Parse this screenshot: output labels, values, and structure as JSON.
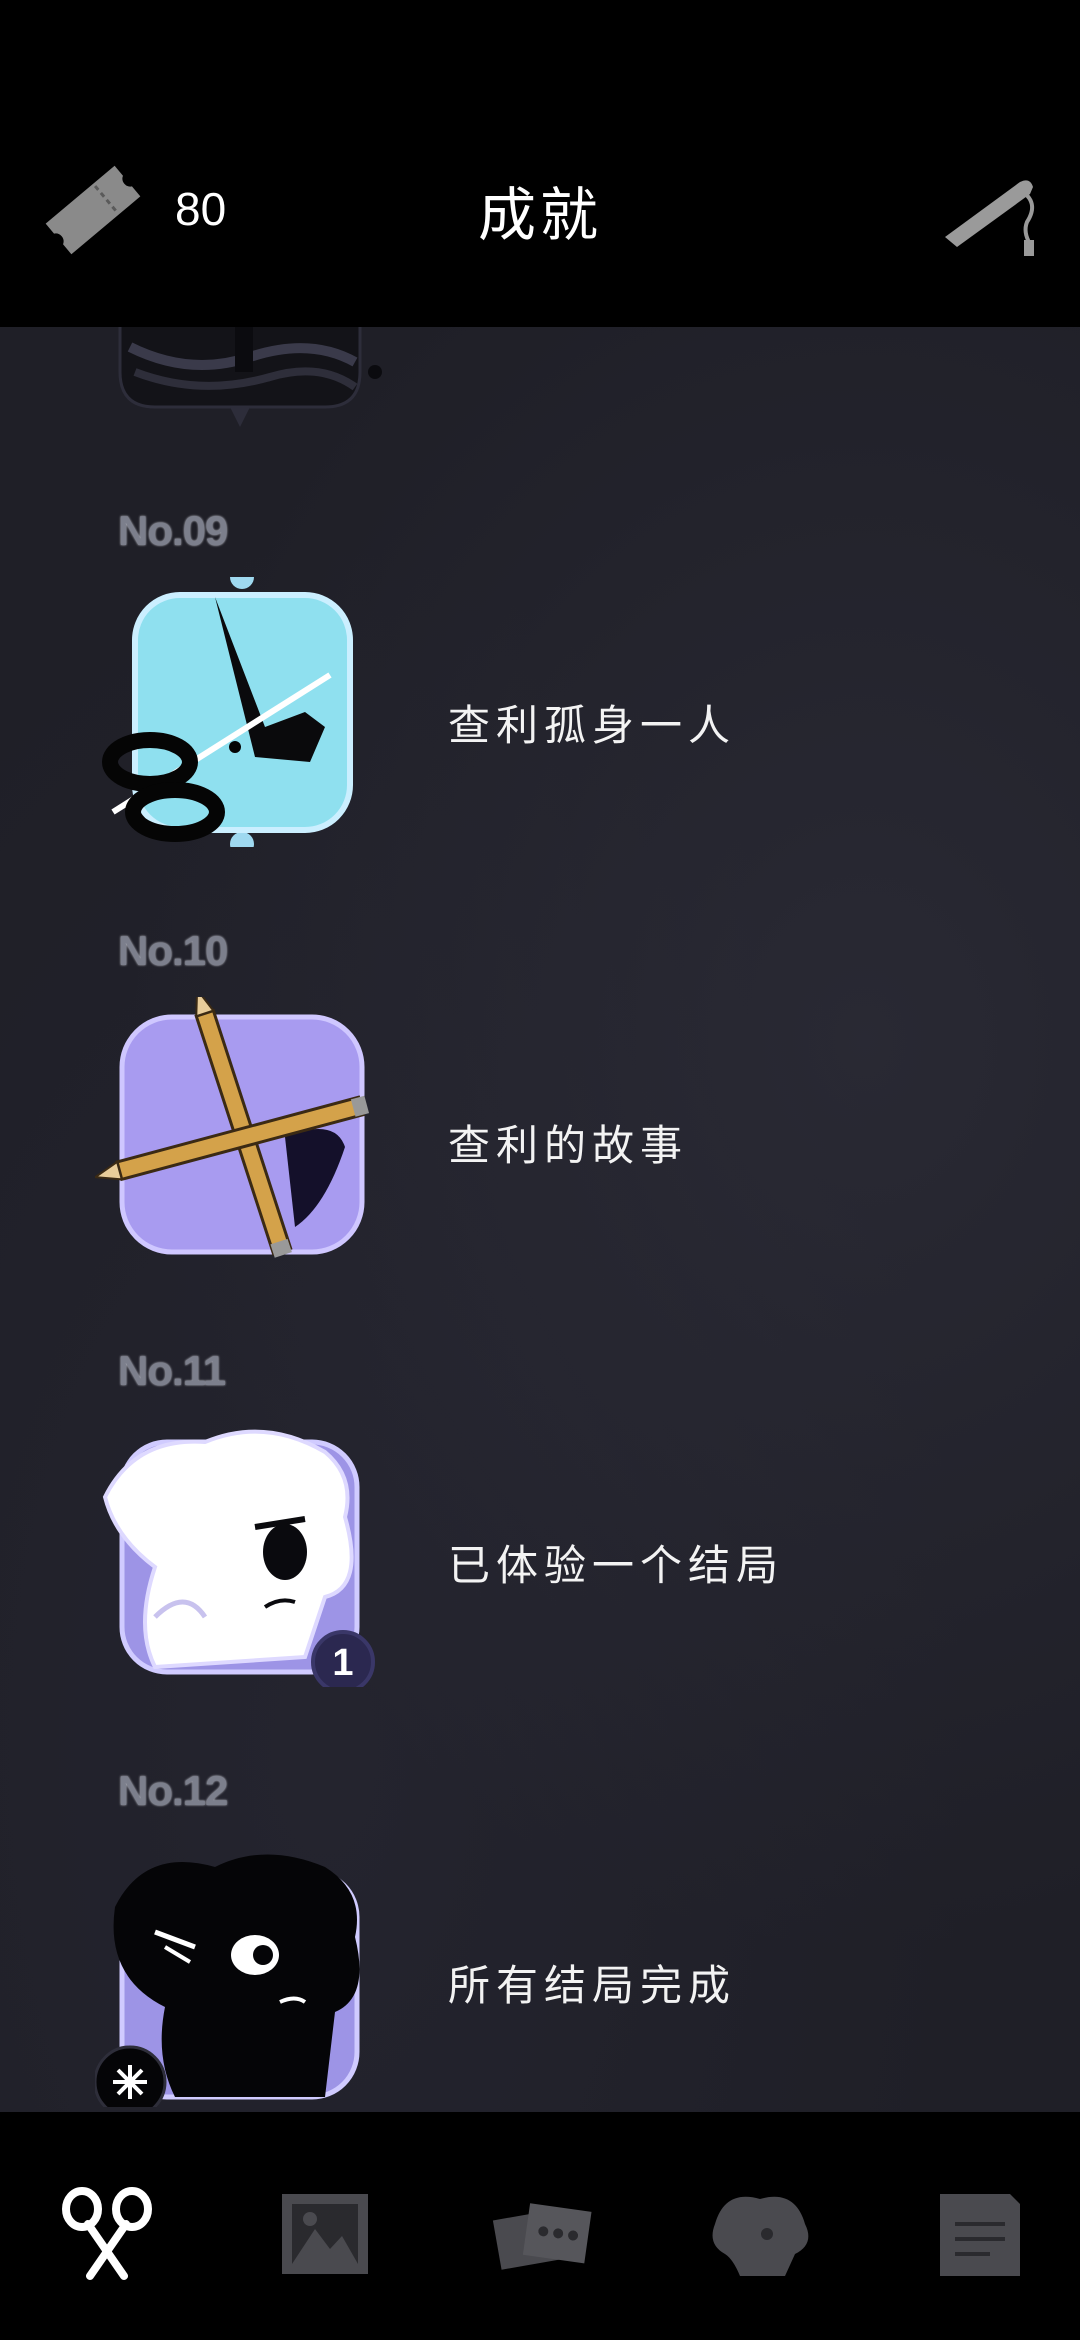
{
  "header": {
    "ticket_count": "80",
    "title": "成就",
    "left_icon": "ticket-icon",
    "right_icon": "whistle-icon"
  },
  "achievements": [
    {
      "number": "No.09",
      "title": "查利孤身一人",
      "icon": "scissors-hand-icon"
    },
    {
      "number": "No.10",
      "title": "查利的故事",
      "icon": "crossed-pencils-icon"
    },
    {
      "number": "No.11",
      "title": "已体验一个结局",
      "icon": "white-character-icon",
      "badge": "1"
    },
    {
      "number": "No.12",
      "title": "所有结局完成",
      "icon": "black-character-icon"
    }
  ],
  "bottom_nav": [
    {
      "icon": "scissors-icon",
      "active": true
    },
    {
      "icon": "gallery-icon",
      "active": false
    },
    {
      "icon": "cards-icon",
      "active": false
    },
    {
      "icon": "character-icon",
      "active": false
    },
    {
      "icon": "notes-icon",
      "active": false
    }
  ],
  "colors": {
    "background": "#1f1f27",
    "header": "#000000",
    "number_text": "#7c7f8c",
    "title_text": "#f3f3f3",
    "nav_inactive": "#4a4a4f",
    "nav_active": "#ffffff"
  }
}
